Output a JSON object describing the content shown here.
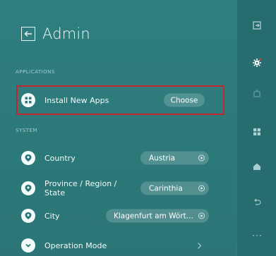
{
  "header": {
    "title": "Admin"
  },
  "sections": {
    "applications": "APPLICATIONS",
    "system": "SYSTEM"
  },
  "install": {
    "label": "Install New Apps",
    "button": "Choose"
  },
  "country": {
    "label": "Country",
    "value": "Austria"
  },
  "province": {
    "label": "Province / Region / State",
    "value": "Carinthia"
  },
  "city": {
    "label": "City",
    "value": "Klagenfurt am Wört..."
  },
  "operation": {
    "label": "Operation Mode"
  },
  "colors": {
    "background": "#2d7a7c",
    "rail": "#276c6e",
    "highlight": "#c3262f"
  },
  "icons": {
    "back": "back-arrow-icon",
    "install": "grid-circle-icon",
    "location": "map-pin-icon",
    "mode": "chevron-circle-icon",
    "rail": [
      "exit-icon",
      "gear-icon",
      "puzzle-icon",
      "apps-grid-icon",
      "home-icon",
      "undo-icon",
      "more-dots-icon"
    ]
  }
}
